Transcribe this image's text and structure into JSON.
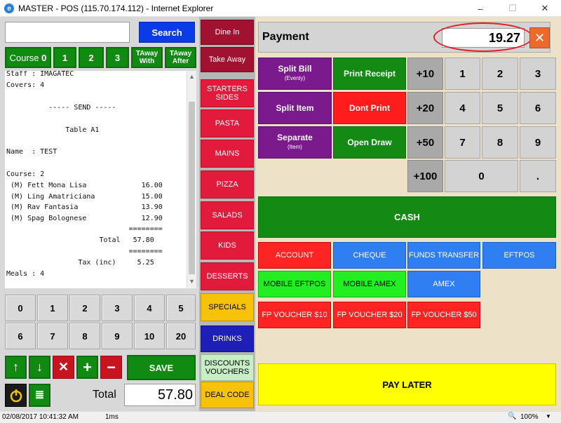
{
  "window": {
    "title": "MASTER - POS (115.70.174.112) - Internet Explorer",
    "minimize": "–",
    "maximize": "☐",
    "close": "✕"
  },
  "search": {
    "value": "",
    "button": "Search"
  },
  "courses": [
    {
      "label": "Course",
      "value": "0"
    },
    {
      "label": "1"
    },
    {
      "label": "2"
    },
    {
      "label": "3"
    },
    {
      "label": "TAway\nWith"
    },
    {
      "label": "TAway\nAfter"
    }
  ],
  "receipt": {
    "lines": [
      "Staff : IMAGATEC",
      "Covers: 4",
      "",
      "          ----- SEND -----",
      "",
      "              Table A1",
      "",
      "Name  : TEST",
      "",
      "Course: 2",
      " (M) Fett Mona Lisa             16.00",
      " (M) Ling Amatriciana           15.00",
      " (M) Rav Fantasia               13.90",
      " (M) Spag Bolognese             12.90",
      "                             ========",
      "                      Total   57.80",
      "                             ========",
      "                 Tax (inc)     5.25",
      "Meals : 4"
    ]
  },
  "keypad": [
    "0",
    "1",
    "2",
    "3",
    "4",
    "5",
    "6",
    "7",
    "8",
    "9",
    "10",
    "20"
  ],
  "actions": {
    "save": "SAVE",
    "up": "↑",
    "down": "↓",
    "remove": "✕",
    "plus": "+",
    "minus": "−"
  },
  "total": {
    "label": "Total",
    "value": "57.80"
  },
  "categories": {
    "dine_in": "Dine In",
    "take_away": "Take Away",
    "items": [
      "STARTERS\nSIDES",
      "PASTA",
      "MAINS",
      "PIZZA",
      "SALADS",
      "KIDS",
      "DESSERTS"
    ],
    "specials": "SPECIALS",
    "drinks": "DRINKS",
    "discounts": "DISCOUNTS\nVOUCHERS",
    "deal_code": "DEAL CODE"
  },
  "payment": {
    "label": "Payment",
    "amount": "19.27",
    "split_bill": "Split Bill",
    "split_bill_sub": "(Evenly)",
    "print_receipt": "Print Receipt",
    "split_item": "Split Item",
    "dont_print": "Dont Print",
    "separate": "Separate",
    "separate_sub": "(Item)",
    "open_draw": "Open Draw",
    "quick": [
      "+10",
      "+20",
      "+50",
      "+100"
    ],
    "digits": [
      "1",
      "2",
      "3",
      "4",
      "5",
      "6",
      "7",
      "8",
      "9",
      "0",
      "."
    ],
    "cash": "CASH",
    "tenders": [
      "ACCOUNT",
      "CHEQUE",
      "FUNDS TRANSFER",
      "EFTPOS",
      "MOBILE EFTPOS",
      "MOBILE AMEX",
      "AMEX",
      "FP VOUCHER $10",
      "FP VOUCHER $20",
      "FP VOUCHER $50"
    ],
    "pay_later": "PAY LATER"
  },
  "status": {
    "datetime": "02/08/2017 10:41:32 AM",
    "ms": "1ms",
    "zoom": "100%"
  },
  "colors": {
    "highlight_ring": "#e31e24",
    "close_btn": "#ee6a2b"
  }
}
